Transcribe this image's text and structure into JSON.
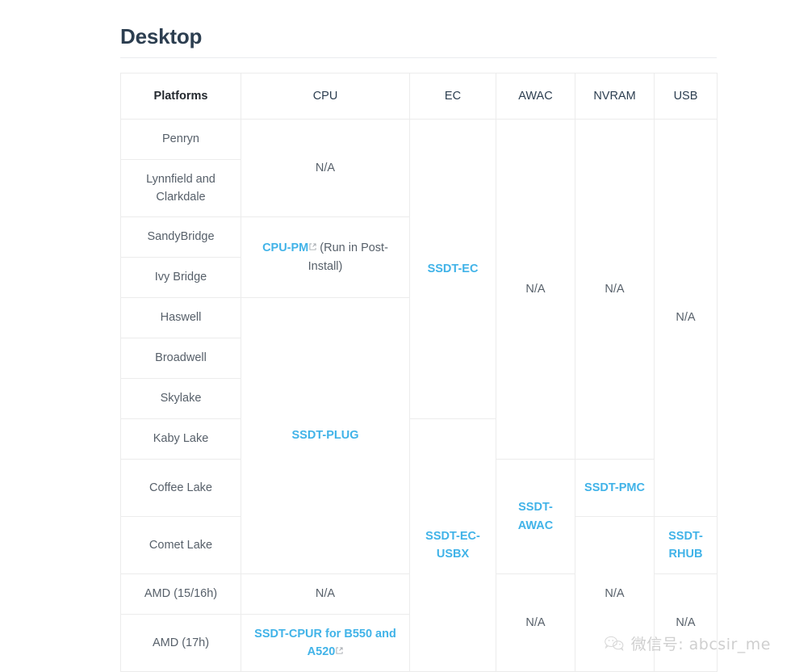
{
  "page": {
    "title": "Desktop"
  },
  "table": {
    "headers": [
      {
        "key": "platforms",
        "label": "Platforms"
      },
      {
        "key": "cpu",
        "label": "CPU"
      },
      {
        "key": "ec",
        "label": "EC"
      },
      {
        "key": "awac",
        "label": "AWAC"
      },
      {
        "key": "nvram",
        "label": "NVRAM"
      },
      {
        "key": "usb",
        "label": "USB"
      }
    ],
    "platforms": [
      {
        "label": "Penryn"
      },
      {
        "label": "Lynnfield and Clarkdale"
      },
      {
        "label": "SandyBridge"
      },
      {
        "label": "Ivy Bridge"
      },
      {
        "label": "Haswell"
      },
      {
        "label": "Broadwell"
      },
      {
        "label": "Skylake"
      },
      {
        "label": "Kaby Lake"
      },
      {
        "label": "Coffee Lake"
      },
      {
        "label": "Comet Lake"
      },
      {
        "label": "AMD (15/16h)"
      },
      {
        "label": "AMD (17h)"
      }
    ],
    "cpu_cells": {
      "na_legacy": "N/A",
      "cpu_pm_link": "CPU-PM",
      "cpu_pm_note": " (Run in Post-Install)",
      "ssdt_plug": "SSDT-PLUG",
      "na_amd15": "N/A",
      "ssdt_cpur": "SSDT-CPUR for B550 and A520"
    },
    "ec_cells": {
      "ssdt_ec": "SSDT-EC",
      "ssdt_ec_usbx": "SSDT-EC-USBX"
    },
    "awac_cells": {
      "na_top": "N/A",
      "ssdt_awac": "SSDT-AWAC",
      "na_bottom": "N/A"
    },
    "nvram_cells": {
      "na_top": "N/A",
      "ssdt_pmc": "SSDT-PMC",
      "na_bottom": "N/A"
    },
    "usb_cells": {
      "na_top": "N/A",
      "ssdt_rhub": "SSDT-RHUB",
      "na_bottom": "N/A"
    }
  },
  "watermark": {
    "text": "微信号: abcsir_me"
  },
  "colors": {
    "link": "#41b3e8",
    "heading": "#2c3e50",
    "text": "#57606a",
    "border": "#ececec",
    "rule": "#eaecef"
  }
}
